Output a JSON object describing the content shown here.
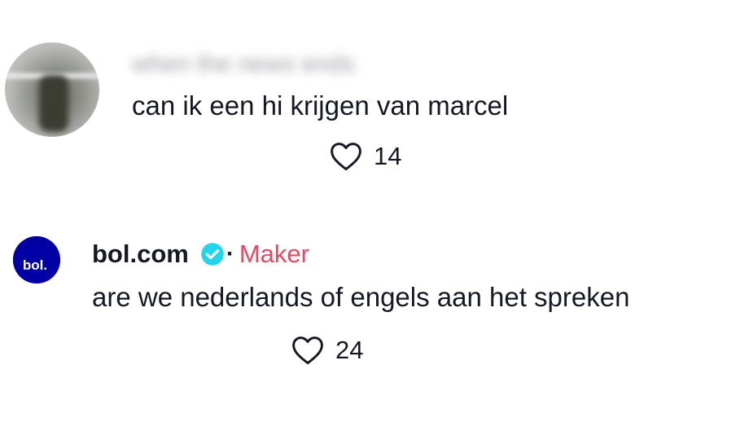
{
  "comments": [
    {
      "username": "when the news ends",
      "text": "can ik een hi krijgen van marcel",
      "likes": "14",
      "avatar_icon": "blurred-photo-avatar"
    },
    {
      "username": "bol.com",
      "verified": true,
      "separator": "·",
      "creator_label": "Maker",
      "text": "are we nederlands of engels aan het spreken",
      "likes": "24",
      "avatar_text": "bol.",
      "avatar_color": "#0000a4"
    }
  ],
  "colors": {
    "text": "#161823",
    "creator_label": "#e8475f",
    "verified_badge": "#20d5ec",
    "heart_outline": "#161823"
  }
}
